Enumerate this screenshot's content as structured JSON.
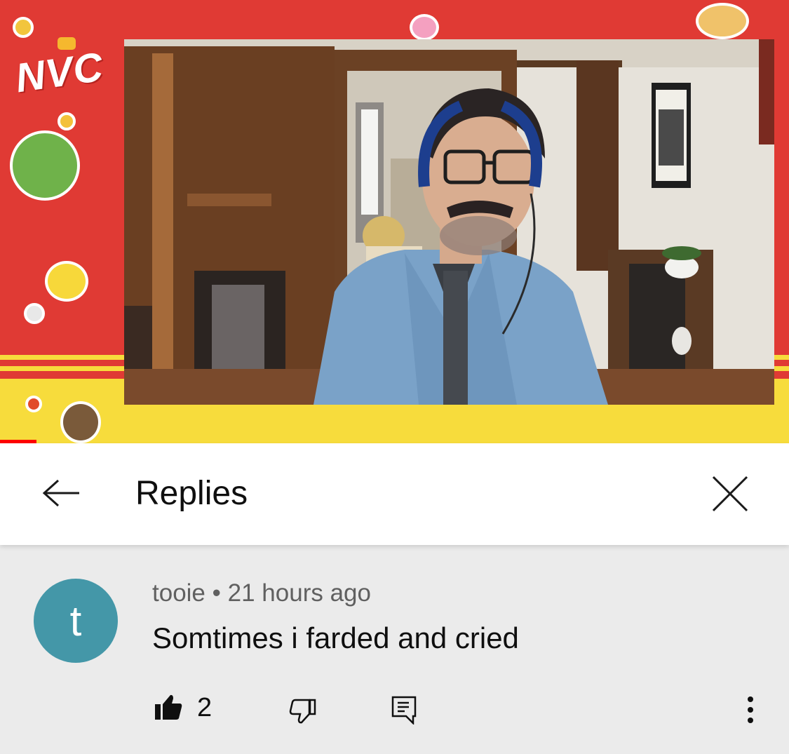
{
  "video": {
    "logo_text": "NVC",
    "colors": {
      "frame_red": "#e03a34",
      "frame_yellow": "#f7dc3c",
      "progress": "#ff0000"
    }
  },
  "header": {
    "back_icon": "arrow-left-icon",
    "title": "Replies",
    "close_icon": "close-icon"
  },
  "comment": {
    "avatar_letter": "t",
    "avatar_color": "#4497a8",
    "author": "tooie",
    "separator": "•",
    "time": "21 hours ago",
    "text": "Somtimes i farded and cried",
    "like_count": "2",
    "icons": [
      "thumbs-up-icon",
      "thumbs-down-icon",
      "reply-icon",
      "more-vertical-icon"
    ]
  }
}
